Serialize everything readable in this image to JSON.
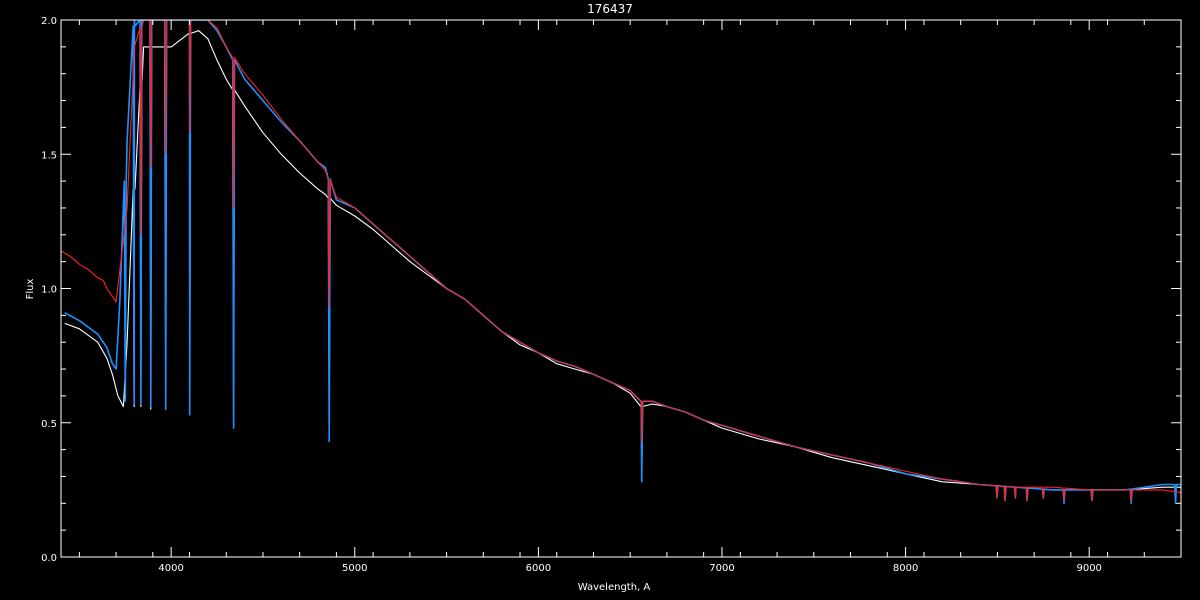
{
  "chart_data": {
    "type": "line",
    "title": "176437",
    "xlabel": "Wavelength, A",
    "ylabel": "Flux",
    "xlim": [
      3400,
      9500
    ],
    "ylim": [
      0,
      2.0
    ],
    "x_ticks": [
      4000,
      5000,
      6000,
      7000,
      8000,
      9000
    ],
    "x_tick_labels": [
      "4000",
      "5000",
      "6000",
      "7000",
      "8000",
      "9000"
    ],
    "y_ticks": [
      0.0,
      0.5,
      1.0,
      1.5,
      2.0
    ],
    "y_tick_labels": [
      "0.0",
      "0.5",
      "1.0",
      "1.5",
      "2.0"
    ],
    "grid": false,
    "background": "#000000",
    "series": [
      {
        "color": "#ffffff",
        "points": [
          [
            3420,
            0.87
          ],
          [
            3500,
            0.85
          ],
          [
            3600,
            0.8
          ],
          [
            3650,
            0.74
          ],
          [
            3680,
            0.68
          ],
          [
            3710,
            0.6
          ],
          [
            3740,
            0.56
          ],
          [
            3760,
            0.8
          ],
          [
            3800,
            1.4
          ],
          [
            3850,
            1.9
          ],
          [
            3900,
            1.9
          ],
          [
            4000,
            1.9
          ],
          [
            4100,
            1.95
          ],
          [
            4150,
            1.96
          ],
          [
            4200,
            1.93
          ],
          [
            4250,
            1.85
          ],
          [
            4300,
            1.78
          ],
          [
            4400,
            1.68
          ],
          [
            4500,
            1.58
          ],
          [
            4600,
            1.5
          ],
          [
            4700,
            1.43
          ],
          [
            4800,
            1.37
          ],
          [
            4840,
            1.35
          ],
          [
            4900,
            1.31
          ],
          [
            5000,
            1.27
          ],
          [
            5100,
            1.22
          ],
          [
            5200,
            1.16
          ],
          [
            5300,
            1.1
          ],
          [
            5400,
            1.05
          ],
          [
            5500,
            1.0
          ],
          [
            5600,
            0.96
          ],
          [
            5700,
            0.9
          ],
          [
            5800,
            0.84
          ],
          [
            5900,
            0.79
          ],
          [
            6000,
            0.76
          ],
          [
            6100,
            0.72
          ],
          [
            6200,
            0.7
          ],
          [
            6300,
            0.68
          ],
          [
            6400,
            0.65
          ],
          [
            6500,
            0.61
          ],
          [
            6560,
            0.56
          ],
          [
            6620,
            0.57
          ],
          [
            6700,
            0.56
          ],
          [
            6800,
            0.54
          ],
          [
            6900,
            0.51
          ],
          [
            7000,
            0.48
          ],
          [
            7200,
            0.44
          ],
          [
            7400,
            0.41
          ],
          [
            7600,
            0.37
          ],
          [
            7800,
            0.34
          ],
          [
            8000,
            0.31
          ],
          [
            8200,
            0.28
          ],
          [
            8400,
            0.27
          ],
          [
            8600,
            0.26
          ],
          [
            8800,
            0.25
          ],
          [
            9000,
            0.25
          ],
          [
            9200,
            0.25
          ],
          [
            9400,
            0.26
          ],
          [
            9500,
            0.26
          ]
        ],
        "dips": [
          [
            3798,
            0.56
          ],
          [
            3835,
            0.56
          ],
          [
            3889,
            0.55
          ],
          [
            3970,
            0.55
          ],
          [
            4101,
            0.53
          ],
          [
            4340,
            0.49
          ],
          [
            4861,
            0.45
          ],
          [
            6563,
            0.3
          ]
        ]
      },
      {
        "color": "#1e90ff",
        "points": [
          [
            3420,
            0.91
          ],
          [
            3500,
            0.88
          ],
          [
            3600,
            0.83
          ],
          [
            3650,
            0.78
          ],
          [
            3680,
            0.72
          ],
          [
            3700,
            0.7
          ],
          [
            3720,
            0.95
          ],
          [
            3760,
            1.55
          ],
          [
            3800,
            2.0
          ],
          [
            3900,
            2.0
          ],
          [
            4000,
            2.0
          ],
          [
            4100,
            2.0
          ],
          [
            4150,
            2.0
          ],
          [
            4200,
            2.0
          ],
          [
            4250,
            1.96
          ],
          [
            4300,
            1.9
          ],
          [
            4400,
            1.78
          ],
          [
            4500,
            1.7
          ],
          [
            4600,
            1.62
          ],
          [
            4700,
            1.55
          ],
          [
            4800,
            1.47
          ],
          [
            4840,
            1.45
          ],
          [
            4900,
            1.33
          ],
          [
            5000,
            1.3
          ],
          [
            5100,
            1.24
          ],
          [
            5200,
            1.18
          ],
          [
            5300,
            1.12
          ],
          [
            5400,
            1.06
          ],
          [
            5500,
            1.0
          ],
          [
            5600,
            0.96
          ],
          [
            5700,
            0.9
          ],
          [
            5800,
            0.84
          ],
          [
            5900,
            0.8
          ],
          [
            6000,
            0.76
          ],
          [
            6100,
            0.73
          ],
          [
            6200,
            0.71
          ],
          [
            6300,
            0.68
          ],
          [
            6400,
            0.65
          ],
          [
            6500,
            0.62
          ],
          [
            6560,
            0.58
          ],
          [
            6620,
            0.58
          ],
          [
            6700,
            0.56
          ],
          [
            6800,
            0.54
          ],
          [
            6900,
            0.51
          ],
          [
            7000,
            0.49
          ],
          [
            7200,
            0.45
          ],
          [
            7400,
            0.41
          ],
          [
            7600,
            0.38
          ],
          [
            7800,
            0.35
          ],
          [
            8000,
            0.31
          ],
          [
            8200,
            0.29
          ],
          [
            8400,
            0.27
          ],
          [
            8600,
            0.26
          ],
          [
            8800,
            0.25
          ],
          [
            9000,
            0.25
          ],
          [
            9200,
            0.25
          ],
          [
            9400,
            0.27
          ],
          [
            9500,
            0.27
          ]
        ],
        "dips": [
          [
            3750,
            0.58
          ],
          [
            3798,
            0.57
          ],
          [
            3835,
            0.57
          ],
          [
            3889,
            0.56
          ],
          [
            3970,
            0.55
          ],
          [
            4101,
            0.53
          ],
          [
            4340,
            0.48
          ],
          [
            4861,
            0.43
          ],
          [
            6563,
            0.28
          ],
          [
            8498,
            0.22
          ],
          [
            8542,
            0.21
          ],
          [
            8598,
            0.22
          ],
          [
            8662,
            0.21
          ],
          [
            8750,
            0.22
          ],
          [
            8863,
            0.2
          ],
          [
            9015,
            0.21
          ],
          [
            9229,
            0.2
          ],
          [
            9470,
            0.2
          ]
        ]
      },
      {
        "color": "#ff2020",
        "points": [
          [
            3400,
            1.14
          ],
          [
            3450,
            1.12
          ],
          [
            3500,
            1.09
          ],
          [
            3550,
            1.07
          ],
          [
            3600,
            1.04
          ],
          [
            3630,
            1.03
          ],
          [
            3650,
            1.0
          ],
          [
            3680,
            0.97
          ],
          [
            3700,
            0.95
          ],
          [
            3760,
            1.3
          ],
          [
            3800,
            1.9
          ],
          [
            3850,
            2.0
          ],
          [
            3900,
            2.0
          ],
          [
            4000,
            2.0
          ],
          [
            4100,
            2.0
          ],
          [
            4200,
            2.0
          ],
          [
            4250,
            1.97
          ],
          [
            4300,
            1.9
          ],
          [
            4400,
            1.8
          ],
          [
            4500,
            1.72
          ],
          [
            4600,
            1.63
          ],
          [
            4700,
            1.55
          ],
          [
            4800,
            1.47
          ],
          [
            4840,
            1.44
          ],
          [
            4900,
            1.34
          ],
          [
            5000,
            1.3
          ],
          [
            5100,
            1.24
          ],
          [
            5200,
            1.18
          ],
          [
            5300,
            1.12
          ],
          [
            5400,
            1.06
          ],
          [
            5500,
            1.0
          ],
          [
            5600,
            0.96
          ],
          [
            5700,
            0.9
          ],
          [
            5800,
            0.84
          ],
          [
            5900,
            0.8
          ],
          [
            6000,
            0.76
          ],
          [
            6100,
            0.73
          ],
          [
            6200,
            0.71
          ],
          [
            6300,
            0.68
          ],
          [
            6400,
            0.65
          ],
          [
            6500,
            0.62
          ],
          [
            6560,
            0.58
          ],
          [
            6620,
            0.58
          ],
          [
            6700,
            0.56
          ],
          [
            6800,
            0.54
          ],
          [
            6900,
            0.51
          ],
          [
            7000,
            0.49
          ],
          [
            7200,
            0.45
          ],
          [
            7400,
            0.41
          ],
          [
            7600,
            0.38
          ],
          [
            7800,
            0.35
          ],
          [
            8000,
            0.32
          ],
          [
            8200,
            0.29
          ],
          [
            8400,
            0.27
          ],
          [
            8600,
            0.26
          ],
          [
            8800,
            0.26
          ],
          [
            9000,
            0.25
          ],
          [
            9200,
            0.25
          ],
          [
            9400,
            0.25
          ],
          [
            9500,
            0.24
          ]
        ],
        "dips": [
          [
            3835,
            1.2
          ],
          [
            3889,
            1.45
          ],
          [
            3970,
            1.5
          ],
          [
            4101,
            1.58
          ],
          [
            4340,
            1.3
          ],
          [
            4861,
            0.93
          ],
          [
            6563,
            0.43
          ],
          [
            8498,
            0.22
          ],
          [
            8542,
            0.21
          ],
          [
            8598,
            0.22
          ],
          [
            8662,
            0.21
          ],
          [
            8750,
            0.22
          ],
          [
            8863,
            0.21
          ],
          [
            9015,
            0.21
          ],
          [
            9229,
            0.21
          ]
        ]
      }
    ]
  }
}
